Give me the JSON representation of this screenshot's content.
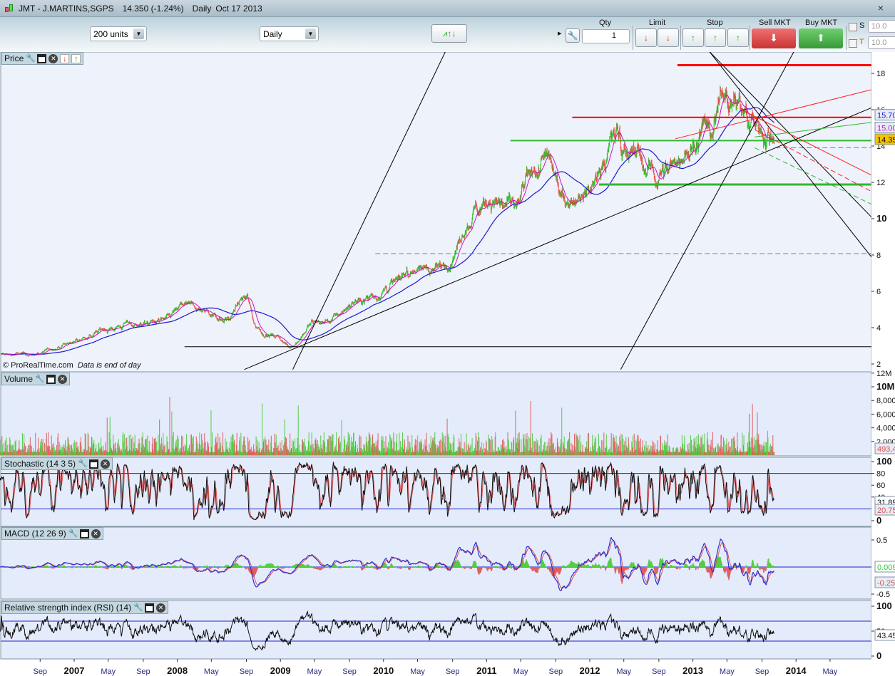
{
  "window": {
    "ticker": "JMT - J.MARTINS,SGPS",
    "price": "14.350 (-1.24%)",
    "period": "Daily",
    "date": "Oct 17 2013",
    "close_label": "×"
  },
  "toolbar": {
    "units": "200 units",
    "timeframe": "Daily",
    "qty_label": "Qty",
    "qty_value": "1",
    "limit_label": "Limit",
    "stop_label": "Stop",
    "sell_label": "Sell MKT",
    "buy_label": "Buy MKT",
    "s_label": "S",
    "t_label": "T",
    "s_value": "10.0",
    "t_value": "10.0"
  },
  "panels": {
    "price": "Price",
    "volume": "Volume",
    "stochastic": "Stochastic (14 3 5)",
    "macd": "MACD (12 26 9)",
    "rsi": "Relative strength index (RSI) (14)"
  },
  "footer": {
    "copyright": "© ProRealTime.com",
    "note": "Data is end of day"
  },
  "tags": {
    "ma_blue": "15.70",
    "ma_pink": "15.00",
    "last": "14.35",
    "volume": "493,4",
    "stoch_k": "31.89",
    "stoch_d": "20.75",
    "macd_hist": "0.009",
    "macd_line": "-0.25",
    "rsi": "43.45"
  },
  "colors": {
    "up": "#2fc22f",
    "down": "#e8504a",
    "ma_short": "#d010c0",
    "ma_long": "#1a1ad0",
    "last_tag": "#f5c400"
  },
  "chart_data": {
    "type": "candlestick",
    "title": "JMT - J.MARTINS,SGPS Daily",
    "x_ticks": [
      "Sep",
      "2007",
      "May",
      "Sep",
      "2008",
      "May",
      "Sep",
      "2009",
      "May",
      "Sep",
      "2010",
      "May",
      "Sep",
      "2011",
      "May",
      "Sep",
      "2012",
      "May",
      "Sep",
      "2013",
      "May",
      "Sep",
      "2014",
      "May"
    ],
    "x_tick_times": [
      2006.67,
      2007,
      2007.33,
      2007.67,
      2008,
      2008.33,
      2008.67,
      2009,
      2009.33,
      2009.67,
      2010,
      2010.33,
      2010.67,
      2011,
      2011.33,
      2011.67,
      2012,
      2012.33,
      2012.67,
      2013,
      2013.33,
      2013.67,
      2014,
      2014.33
    ],
    "price_ticks": [
      "18",
      "16",
      "14",
      "12",
      "10",
      "8",
      "6",
      "4",
      "2"
    ],
    "price_tick_values": [
      18,
      16,
      14,
      12,
      10,
      8,
      6,
      4,
      2
    ],
    "volume_ticks": [
      "12M",
      "10M",
      "8,000",
      "6,000",
      "4,000",
      "2,000"
    ],
    "volume_tick_values": [
      12,
      10,
      8,
      6,
      4,
      2
    ],
    "stoch_ticks": [
      "100",
      "80",
      "60",
      "40",
      "0"
    ],
    "stoch_tick_values": [
      100,
      80,
      60,
      40,
      0
    ],
    "macd_ticks": [
      "0.5",
      "-0.5"
    ],
    "macd_tick_values": [
      0.5,
      -0.5
    ],
    "rsi_ticks": [
      "100",
      "50",
      "0"
    ],
    "rsi_tick_values": [
      100,
      50,
      0
    ],
    "price_range": [
      1.5,
      19.3
    ],
    "price_anchors": [
      [
        2006.28,
        2.5
      ],
      [
        2006.6,
        2.5
      ],
      [
        2007.0,
        3.2
      ],
      [
        2007.3,
        4.0
      ],
      [
        2007.6,
        4.2
      ],
      [
        2007.9,
        4.4
      ],
      [
        2008.05,
        5.2
      ],
      [
        2008.3,
        4.8
      ],
      [
        2008.5,
        4.6
      ],
      [
        2008.68,
        5.7
      ],
      [
        2008.76,
        4.0
      ],
      [
        2009.0,
        3.3
      ],
      [
        2009.1,
        2.9
      ],
      [
        2009.3,
        4.2
      ],
      [
        2009.5,
        4.4
      ],
      [
        2009.7,
        5.5
      ],
      [
        2010.0,
        6.2
      ],
      [
        2010.3,
        7.2
      ],
      [
        2010.6,
        7.4
      ],
      [
        2010.8,
        9.5
      ],
      [
        2011.0,
        11.5
      ],
      [
        2011.3,
        10.5
      ],
      [
        2011.55,
        13.2
      ],
      [
        2011.75,
        11.2
      ],
      [
        2012.0,
        12.0
      ],
      [
        2012.25,
        15.0
      ],
      [
        2012.5,
        13.2
      ],
      [
        2012.65,
        12.3
      ],
      [
        2012.9,
        13.5
      ],
      [
        2013.05,
        14.8
      ],
      [
        2013.2,
        15.5
      ],
      [
        2013.33,
        17.8
      ],
      [
        2013.5,
        16.0
      ],
      [
        2013.65,
        14.6
      ],
      [
        2013.79,
        14.35
      ]
    ],
    "drawings": [
      {
        "type": "hline",
        "color": "#ff0000",
        "width": 3,
        "from": 2012.85,
        "price": 18.45
      },
      {
        "type": "hline",
        "color": "#ff0000",
        "width": 2,
        "from": 2011.83,
        "price": 15.58
      },
      {
        "type": "hline",
        "color": "#2fb82f",
        "width": 2,
        "from": 2011.23,
        "price": 14.3
      },
      {
        "type": "hline",
        "color": "#2fb82f",
        "width": 3,
        "from": 2012.09,
        "price": 11.88
      },
      {
        "type": "hline",
        "color": "#2fb82f",
        "width": 1,
        "dash": true,
        "from": 2009.92,
        "price": 8.08
      },
      {
        "type": "hline",
        "color": "#2fb82f",
        "width": 1,
        "dash": true,
        "from": 2013.8,
        "price": 13.9
      },
      {
        "type": "hline",
        "color": "#000000",
        "width": 1,
        "from": 2008.07,
        "price": 2.95
      },
      {
        "type": "line",
        "color": "#000000",
        "p1": [
          2008.65,
          1.7
        ],
        "p2": [
          2014.73,
          16.1
        ]
      },
      {
        "type": "line",
        "color": "#000000",
        "p1": [
          2009.12,
          1.7
        ],
        "p2": [
          2010.6,
          19.2
        ]
      },
      {
        "type": "line",
        "color": "#000000",
        "p1": [
          2012.3,
          1.7
        ],
        "p2": [
          2013.98,
          19.2
        ]
      },
      {
        "type": "line",
        "color": "#000000",
        "p1": [
          2013.16,
          19.2
        ],
        "p2": [
          2014.73,
          10.1
        ]
      },
      {
        "type": "line",
        "color": "#000000",
        "p1": [
          2013.16,
          19.2
        ],
        "p2": [
          2014.73,
          7.9
        ]
      },
      {
        "type": "line",
        "color": "#ff2020",
        "p1": [
          2012.83,
          14.4
        ],
        "p2": [
          2014.73,
          17.1
        ]
      },
      {
        "type": "line",
        "color": "#ff2020",
        "p1": [
          2013.47,
          16.0
        ],
        "p2": [
          2014.73,
          12.4
        ]
      },
      {
        "type": "line",
        "color": "#ff2020",
        "dash": true,
        "p1": [
          2013.6,
          14.9
        ],
        "p2": [
          2014.73,
          11.5
        ]
      },
      {
        "type": "line",
        "color": "#2fb82f",
        "p1": [
          2013.6,
          14.5
        ],
        "p2": [
          2014.73,
          15.3
        ]
      },
      {
        "type": "line",
        "color": "#2fb82f",
        "dash": true,
        "p1": [
          2013.6,
          13.9
        ],
        "p2": [
          2014.73,
          10.8
        ]
      }
    ],
    "stoch_levels": [
      80,
      20
    ],
    "rsi_levels": [
      70,
      30
    ]
  }
}
